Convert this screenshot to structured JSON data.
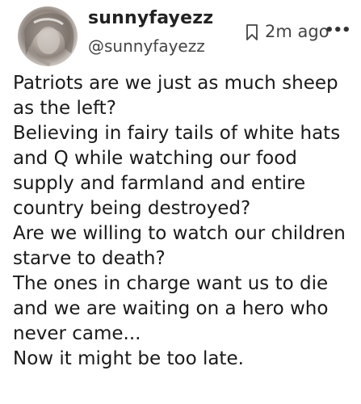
{
  "user": {
    "display_name": "sunnyfayezz",
    "handle": "@sunnyfayezz"
  },
  "meta": {
    "time_ago": "2m ago",
    "bookmark_icon": "bookmark-icon",
    "more_icon": "more-options-icon",
    "more_glyph": "•••"
  },
  "post": {
    "lines": [
      "Patriots are we just as much sheep",
      "as the left?",
      "Believing in fairy tails of white hats",
      "and Q while watching our food",
      "supply and farmland and entire",
      "country being destroyed?",
      "Are we willing to watch our children",
      "starve to death?",
      "The ones in charge want us to die",
      "and we are waiting on a hero who",
      "never came...",
      "Now it might be too late."
    ]
  }
}
